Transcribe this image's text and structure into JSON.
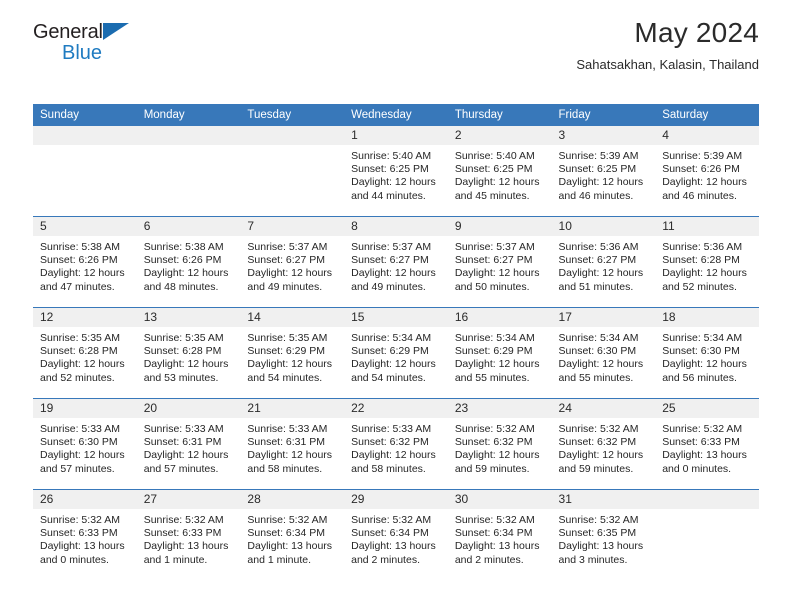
{
  "brand": {
    "name_top": "General",
    "name_bottom": "Blue",
    "triangle_color": "#1b6cb0",
    "blue_text_color": "#1f7bc1"
  },
  "header": {
    "title": "May 2024",
    "subtitle": "Sahatsakhan, Kalasin, Thailand"
  },
  "theme": {
    "header_row_bg": "#3878ba",
    "day_number_bg": "#f0f0f0",
    "page_bg": "#ffffff",
    "text_color": "#262626"
  },
  "weekday_headers": [
    "Sunday",
    "Monday",
    "Tuesday",
    "Wednesday",
    "Thursday",
    "Friday",
    "Saturday"
  ],
  "weeks": [
    [
      {
        "day": "",
        "empty": true,
        "sunrise": "",
        "sunset": "",
        "daylight_line1": "",
        "daylight_line2": ""
      },
      {
        "day": "",
        "empty": true,
        "sunrise": "",
        "sunset": "",
        "daylight_line1": "",
        "daylight_line2": ""
      },
      {
        "day": "",
        "empty": true,
        "sunrise": "",
        "sunset": "",
        "daylight_line1": "",
        "daylight_line2": ""
      },
      {
        "day": "1",
        "empty": false,
        "sunrise": "Sunrise: 5:40 AM",
        "sunset": "Sunset: 6:25 PM",
        "daylight_line1": "Daylight: 12 hours",
        "daylight_line2": "and 44 minutes."
      },
      {
        "day": "2",
        "empty": false,
        "sunrise": "Sunrise: 5:40 AM",
        "sunset": "Sunset: 6:25 PM",
        "daylight_line1": "Daylight: 12 hours",
        "daylight_line2": "and 45 minutes."
      },
      {
        "day": "3",
        "empty": false,
        "sunrise": "Sunrise: 5:39 AM",
        "sunset": "Sunset: 6:25 PM",
        "daylight_line1": "Daylight: 12 hours",
        "daylight_line2": "and 46 minutes."
      },
      {
        "day": "4",
        "empty": false,
        "sunrise": "Sunrise: 5:39 AM",
        "sunset": "Sunset: 6:26 PM",
        "daylight_line1": "Daylight: 12 hours",
        "daylight_line2": "and 46 minutes."
      }
    ],
    [
      {
        "day": "5",
        "empty": false,
        "sunrise": "Sunrise: 5:38 AM",
        "sunset": "Sunset: 6:26 PM",
        "daylight_line1": "Daylight: 12 hours",
        "daylight_line2": "and 47 minutes."
      },
      {
        "day": "6",
        "empty": false,
        "sunrise": "Sunrise: 5:38 AM",
        "sunset": "Sunset: 6:26 PM",
        "daylight_line1": "Daylight: 12 hours",
        "daylight_line2": "and 48 minutes."
      },
      {
        "day": "7",
        "empty": false,
        "sunrise": "Sunrise: 5:37 AM",
        "sunset": "Sunset: 6:27 PM",
        "daylight_line1": "Daylight: 12 hours",
        "daylight_line2": "and 49 minutes."
      },
      {
        "day": "8",
        "empty": false,
        "sunrise": "Sunrise: 5:37 AM",
        "sunset": "Sunset: 6:27 PM",
        "daylight_line1": "Daylight: 12 hours",
        "daylight_line2": "and 49 minutes."
      },
      {
        "day": "9",
        "empty": false,
        "sunrise": "Sunrise: 5:37 AM",
        "sunset": "Sunset: 6:27 PM",
        "daylight_line1": "Daylight: 12 hours",
        "daylight_line2": "and 50 minutes."
      },
      {
        "day": "10",
        "empty": false,
        "sunrise": "Sunrise: 5:36 AM",
        "sunset": "Sunset: 6:27 PM",
        "daylight_line1": "Daylight: 12 hours",
        "daylight_line2": "and 51 minutes."
      },
      {
        "day": "11",
        "empty": false,
        "sunrise": "Sunrise: 5:36 AM",
        "sunset": "Sunset: 6:28 PM",
        "daylight_line1": "Daylight: 12 hours",
        "daylight_line2": "and 52 minutes."
      }
    ],
    [
      {
        "day": "12",
        "empty": false,
        "sunrise": "Sunrise: 5:35 AM",
        "sunset": "Sunset: 6:28 PM",
        "daylight_line1": "Daylight: 12 hours",
        "daylight_line2": "and 52 minutes."
      },
      {
        "day": "13",
        "empty": false,
        "sunrise": "Sunrise: 5:35 AM",
        "sunset": "Sunset: 6:28 PM",
        "daylight_line1": "Daylight: 12 hours",
        "daylight_line2": "and 53 minutes."
      },
      {
        "day": "14",
        "empty": false,
        "sunrise": "Sunrise: 5:35 AM",
        "sunset": "Sunset: 6:29 PM",
        "daylight_line1": "Daylight: 12 hours",
        "daylight_line2": "and 54 minutes."
      },
      {
        "day": "15",
        "empty": false,
        "sunrise": "Sunrise: 5:34 AM",
        "sunset": "Sunset: 6:29 PM",
        "daylight_line1": "Daylight: 12 hours",
        "daylight_line2": "and 54 minutes."
      },
      {
        "day": "16",
        "empty": false,
        "sunrise": "Sunrise: 5:34 AM",
        "sunset": "Sunset: 6:29 PM",
        "daylight_line1": "Daylight: 12 hours",
        "daylight_line2": "and 55 minutes."
      },
      {
        "day": "17",
        "empty": false,
        "sunrise": "Sunrise: 5:34 AM",
        "sunset": "Sunset: 6:30 PM",
        "daylight_line1": "Daylight: 12 hours",
        "daylight_line2": "and 55 minutes."
      },
      {
        "day": "18",
        "empty": false,
        "sunrise": "Sunrise: 5:34 AM",
        "sunset": "Sunset: 6:30 PM",
        "daylight_line1": "Daylight: 12 hours",
        "daylight_line2": "and 56 minutes."
      }
    ],
    [
      {
        "day": "19",
        "empty": false,
        "sunrise": "Sunrise: 5:33 AM",
        "sunset": "Sunset: 6:30 PM",
        "daylight_line1": "Daylight: 12 hours",
        "daylight_line2": "and 57 minutes."
      },
      {
        "day": "20",
        "empty": false,
        "sunrise": "Sunrise: 5:33 AM",
        "sunset": "Sunset: 6:31 PM",
        "daylight_line1": "Daylight: 12 hours",
        "daylight_line2": "and 57 minutes."
      },
      {
        "day": "21",
        "empty": false,
        "sunrise": "Sunrise: 5:33 AM",
        "sunset": "Sunset: 6:31 PM",
        "daylight_line1": "Daylight: 12 hours",
        "daylight_line2": "and 58 minutes."
      },
      {
        "day": "22",
        "empty": false,
        "sunrise": "Sunrise: 5:33 AM",
        "sunset": "Sunset: 6:32 PM",
        "daylight_line1": "Daylight: 12 hours",
        "daylight_line2": "and 58 minutes."
      },
      {
        "day": "23",
        "empty": false,
        "sunrise": "Sunrise: 5:32 AM",
        "sunset": "Sunset: 6:32 PM",
        "daylight_line1": "Daylight: 12 hours",
        "daylight_line2": "and 59 minutes."
      },
      {
        "day": "24",
        "empty": false,
        "sunrise": "Sunrise: 5:32 AM",
        "sunset": "Sunset: 6:32 PM",
        "daylight_line1": "Daylight: 12 hours",
        "daylight_line2": "and 59 minutes."
      },
      {
        "day": "25",
        "empty": false,
        "sunrise": "Sunrise: 5:32 AM",
        "sunset": "Sunset: 6:33 PM",
        "daylight_line1": "Daylight: 13 hours",
        "daylight_line2": "and 0 minutes."
      }
    ],
    [
      {
        "day": "26",
        "empty": false,
        "sunrise": "Sunrise: 5:32 AM",
        "sunset": "Sunset: 6:33 PM",
        "daylight_line1": "Daylight: 13 hours",
        "daylight_line2": "and 0 minutes."
      },
      {
        "day": "27",
        "empty": false,
        "sunrise": "Sunrise: 5:32 AM",
        "sunset": "Sunset: 6:33 PM",
        "daylight_line1": "Daylight: 13 hours",
        "daylight_line2": "and 1 minute."
      },
      {
        "day": "28",
        "empty": false,
        "sunrise": "Sunrise: 5:32 AM",
        "sunset": "Sunset: 6:34 PM",
        "daylight_line1": "Daylight: 13 hours",
        "daylight_line2": "and 1 minute."
      },
      {
        "day": "29",
        "empty": false,
        "sunrise": "Sunrise: 5:32 AM",
        "sunset": "Sunset: 6:34 PM",
        "daylight_line1": "Daylight: 13 hours",
        "daylight_line2": "and 2 minutes."
      },
      {
        "day": "30",
        "empty": false,
        "sunrise": "Sunrise: 5:32 AM",
        "sunset": "Sunset: 6:34 PM",
        "daylight_line1": "Daylight: 13 hours",
        "daylight_line2": "and 2 minutes."
      },
      {
        "day": "31",
        "empty": false,
        "sunrise": "Sunrise: 5:32 AM",
        "sunset": "Sunset: 6:35 PM",
        "daylight_line1": "Daylight: 13 hours",
        "daylight_line2": "and 3 minutes."
      },
      {
        "day": "",
        "empty": true,
        "sunrise": "",
        "sunset": "",
        "daylight_line1": "",
        "daylight_line2": ""
      }
    ]
  ]
}
